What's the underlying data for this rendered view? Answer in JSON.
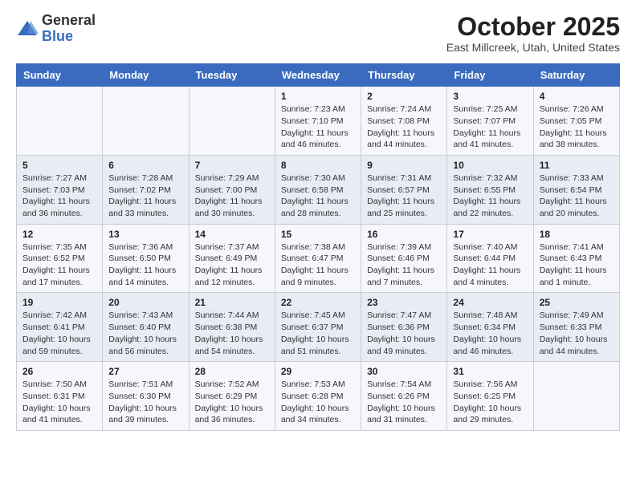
{
  "header": {
    "logo_general": "General",
    "logo_blue": "Blue",
    "title": "October 2025",
    "subtitle": "East Millcreek, Utah, United States"
  },
  "weekdays": [
    "Sunday",
    "Monday",
    "Tuesday",
    "Wednesday",
    "Thursday",
    "Friday",
    "Saturday"
  ],
  "weeks": [
    [
      {
        "day": "",
        "info": ""
      },
      {
        "day": "",
        "info": ""
      },
      {
        "day": "",
        "info": ""
      },
      {
        "day": "1",
        "info": "Sunrise: 7:23 AM\nSunset: 7:10 PM\nDaylight: 11 hours and 46 minutes."
      },
      {
        "day": "2",
        "info": "Sunrise: 7:24 AM\nSunset: 7:08 PM\nDaylight: 11 hours and 44 minutes."
      },
      {
        "day": "3",
        "info": "Sunrise: 7:25 AM\nSunset: 7:07 PM\nDaylight: 11 hours and 41 minutes."
      },
      {
        "day": "4",
        "info": "Sunrise: 7:26 AM\nSunset: 7:05 PM\nDaylight: 11 hours and 38 minutes."
      }
    ],
    [
      {
        "day": "5",
        "info": "Sunrise: 7:27 AM\nSunset: 7:03 PM\nDaylight: 11 hours and 36 minutes."
      },
      {
        "day": "6",
        "info": "Sunrise: 7:28 AM\nSunset: 7:02 PM\nDaylight: 11 hours and 33 minutes."
      },
      {
        "day": "7",
        "info": "Sunrise: 7:29 AM\nSunset: 7:00 PM\nDaylight: 11 hours and 30 minutes."
      },
      {
        "day": "8",
        "info": "Sunrise: 7:30 AM\nSunset: 6:58 PM\nDaylight: 11 hours and 28 minutes."
      },
      {
        "day": "9",
        "info": "Sunrise: 7:31 AM\nSunset: 6:57 PM\nDaylight: 11 hours and 25 minutes."
      },
      {
        "day": "10",
        "info": "Sunrise: 7:32 AM\nSunset: 6:55 PM\nDaylight: 11 hours and 22 minutes."
      },
      {
        "day": "11",
        "info": "Sunrise: 7:33 AM\nSunset: 6:54 PM\nDaylight: 11 hours and 20 minutes."
      }
    ],
    [
      {
        "day": "12",
        "info": "Sunrise: 7:35 AM\nSunset: 6:52 PM\nDaylight: 11 hours and 17 minutes."
      },
      {
        "day": "13",
        "info": "Sunrise: 7:36 AM\nSunset: 6:50 PM\nDaylight: 11 hours and 14 minutes."
      },
      {
        "day": "14",
        "info": "Sunrise: 7:37 AM\nSunset: 6:49 PM\nDaylight: 11 hours and 12 minutes."
      },
      {
        "day": "15",
        "info": "Sunrise: 7:38 AM\nSunset: 6:47 PM\nDaylight: 11 hours and 9 minutes."
      },
      {
        "day": "16",
        "info": "Sunrise: 7:39 AM\nSunset: 6:46 PM\nDaylight: 11 hours and 7 minutes."
      },
      {
        "day": "17",
        "info": "Sunrise: 7:40 AM\nSunset: 6:44 PM\nDaylight: 11 hours and 4 minutes."
      },
      {
        "day": "18",
        "info": "Sunrise: 7:41 AM\nSunset: 6:43 PM\nDaylight: 11 hours and 1 minute."
      }
    ],
    [
      {
        "day": "19",
        "info": "Sunrise: 7:42 AM\nSunset: 6:41 PM\nDaylight: 10 hours and 59 minutes."
      },
      {
        "day": "20",
        "info": "Sunrise: 7:43 AM\nSunset: 6:40 PM\nDaylight: 10 hours and 56 minutes."
      },
      {
        "day": "21",
        "info": "Sunrise: 7:44 AM\nSunset: 6:38 PM\nDaylight: 10 hours and 54 minutes."
      },
      {
        "day": "22",
        "info": "Sunrise: 7:45 AM\nSunset: 6:37 PM\nDaylight: 10 hours and 51 minutes."
      },
      {
        "day": "23",
        "info": "Sunrise: 7:47 AM\nSunset: 6:36 PM\nDaylight: 10 hours and 49 minutes."
      },
      {
        "day": "24",
        "info": "Sunrise: 7:48 AM\nSunset: 6:34 PM\nDaylight: 10 hours and 46 minutes."
      },
      {
        "day": "25",
        "info": "Sunrise: 7:49 AM\nSunset: 6:33 PM\nDaylight: 10 hours and 44 minutes."
      }
    ],
    [
      {
        "day": "26",
        "info": "Sunrise: 7:50 AM\nSunset: 6:31 PM\nDaylight: 10 hours and 41 minutes."
      },
      {
        "day": "27",
        "info": "Sunrise: 7:51 AM\nSunset: 6:30 PM\nDaylight: 10 hours and 39 minutes."
      },
      {
        "day": "28",
        "info": "Sunrise: 7:52 AM\nSunset: 6:29 PM\nDaylight: 10 hours and 36 minutes."
      },
      {
        "day": "29",
        "info": "Sunrise: 7:53 AM\nSunset: 6:28 PM\nDaylight: 10 hours and 34 minutes."
      },
      {
        "day": "30",
        "info": "Sunrise: 7:54 AM\nSunset: 6:26 PM\nDaylight: 10 hours and 31 minutes."
      },
      {
        "day": "31",
        "info": "Sunrise: 7:56 AM\nSunset: 6:25 PM\nDaylight: 10 hours and 29 minutes."
      },
      {
        "day": "",
        "info": ""
      }
    ]
  ]
}
